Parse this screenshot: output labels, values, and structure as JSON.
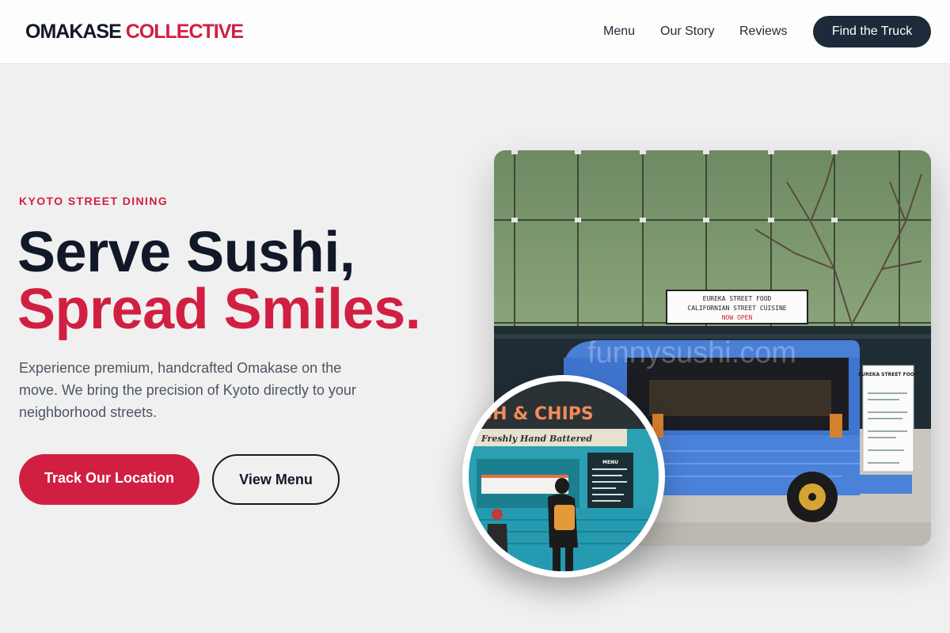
{
  "header": {
    "logo_part1": "OMAKASE",
    "logo_part2": "COLLECTIVE",
    "nav": [
      "Menu",
      "Our Story",
      "Reviews"
    ],
    "cta": "Find the Truck"
  },
  "hero": {
    "eyebrow": "KYOTO STREET DINING",
    "headline_line1": "Serve Sushi,",
    "headline_line2": "Spread Smiles.",
    "description": "Experience premium, handcrafted Omakase on the move. We bring the precision of Kyoto directly to your neighborhood streets.",
    "primary_button": "Track Our Location",
    "secondary_button": "View Menu"
  },
  "photos": {
    "main": {
      "sign_line1": "EUREKA STREET FOOD",
      "sign_line2": "CALIFORNIAN STREET CUISINE",
      "sign_line3": "NOW OPEN",
      "watermark": "funnysushi.com",
      "menu_board_title": "EUREKA STREET FOOD"
    },
    "inset": {
      "sign": "SH & CHIPS",
      "subsign": "Freshly Hand Battered",
      "menu_label": "MENU"
    }
  },
  "colors": {
    "accent": "#d11f42",
    "dark": "#111827",
    "button_dark": "#1e293b",
    "background": "#f0f0f0"
  }
}
